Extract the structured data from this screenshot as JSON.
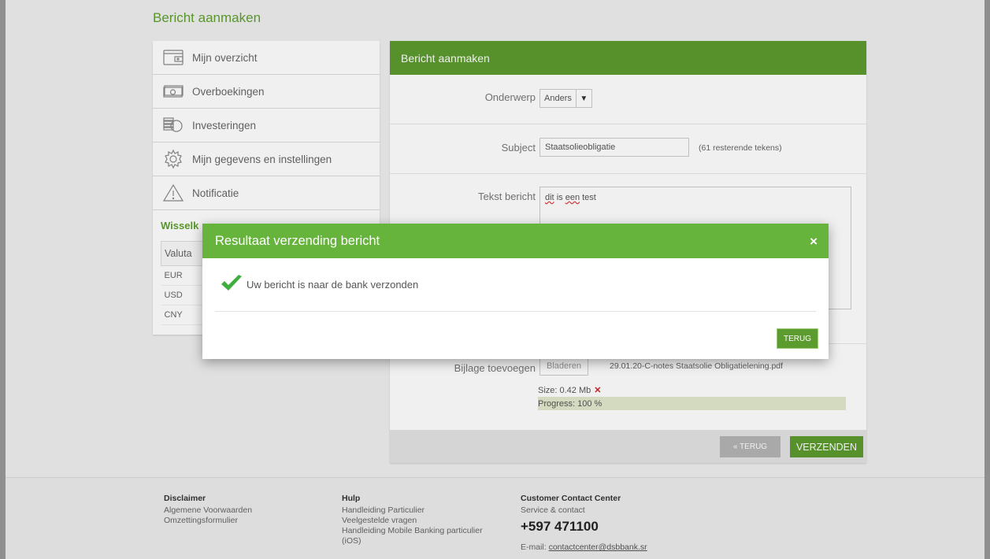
{
  "page": {
    "title": "Bericht aanmaken"
  },
  "sidebar": {
    "items": [
      {
        "label": "Mijn overzicht",
        "icon": "wallet-icon"
      },
      {
        "label": "Overboekingen",
        "icon": "banknote-icon"
      },
      {
        "label": "Investeringen",
        "icon": "coins-icon"
      },
      {
        "label": "Mijn gegevens en instellingen",
        "icon": "gear-icon"
      },
      {
        "label": "Notificatie",
        "icon": "warning-icon"
      }
    ],
    "fx": {
      "title": "Wisselk",
      "header": "Valuta",
      "rows": [
        "EUR",
        "USD",
        "CNY"
      ]
    }
  },
  "form": {
    "header": "Bericht aanmaken",
    "onderwerp_label": "Onderwerp",
    "onderwerp_value": "Anders",
    "subject_label": "Subject",
    "subject_value": "Staatsolieobligatie",
    "subject_hint": "(61 resterende tekens)",
    "tekst_label": "Tekst bericht",
    "tekst_word1": "dit",
    "tekst_word2": "is",
    "tekst_word3": "een",
    "tekst_word4": "test",
    "bijlage_label": "Bijlage toevoegen",
    "browse_label": "Bladeren",
    "file_name": "29.01.20-C-notes Staatsolie Obligatielening.pdf",
    "size_text": "Size: 0.42 Mb",
    "remove_glyph": "✕",
    "progress_text": "Progress: 100 %",
    "progress_fraction": 1.0,
    "back_label": "« TERUG",
    "send_label": "VERZENDEN"
  },
  "footer": {
    "disclaimer": {
      "title": "Disclaimer",
      "links": [
        "Algemene Voorwaarden",
        "Omzettingsformulier"
      ]
    },
    "hulp": {
      "title": "Hulp",
      "links": [
        "Handleiding Particulier",
        "Veelgestelde vragen",
        "Handleiding Mobile Banking particulier (iOS)"
      ]
    },
    "contact": {
      "title": "Customer Contact Center",
      "subtitle": "Service & contact",
      "phone": "+597 471100",
      "email_label": "E-mail:",
      "email": "contactcenter@dsbbank.sr"
    }
  },
  "modal": {
    "title": "Resultaat verzending bericht",
    "close_glyph": "×",
    "message": "Uw bericht is naar de bank verzonden",
    "button_label": "TERUG",
    "icon": "check-icon"
  },
  "colors": {
    "brand_green": "#5c9b2e",
    "modal_green": "#66b43c"
  }
}
